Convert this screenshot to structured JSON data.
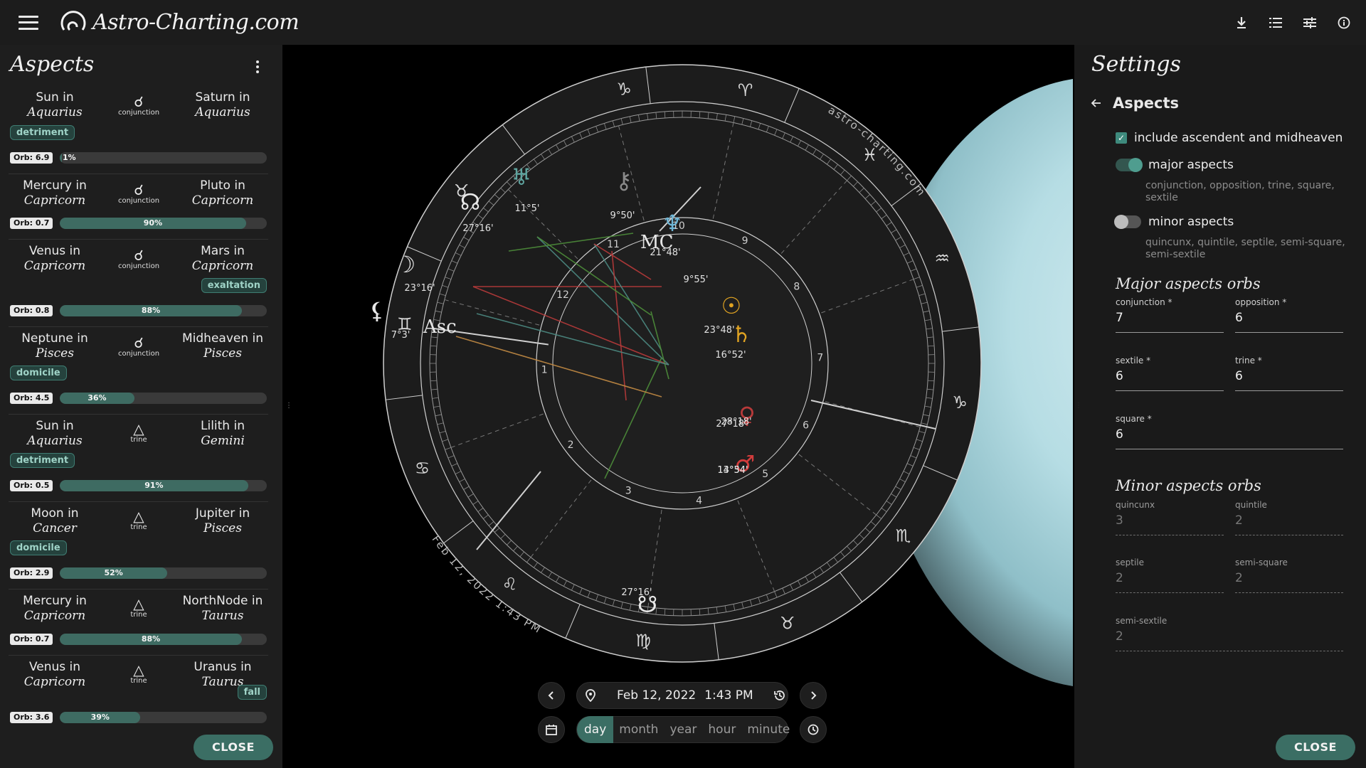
{
  "app": {
    "logo_text": "Astro-Charting.com"
  },
  "topbar": {
    "icons": [
      "menu-icon",
      "download-icon",
      "list-icon",
      "tune-icon",
      "info-icon"
    ]
  },
  "left_panel": {
    "title": "Aspects",
    "close_label": "CLOSE",
    "aspects": [
      {
        "body1": "Sun in",
        "sign1": "Aquarius",
        "aspect": "conjunction",
        "symbol": "☌",
        "body2": "Saturn in",
        "sign2": "Aquarius",
        "badge1": "detriment",
        "badge2": "",
        "orb": "Orb: 6.9",
        "pct": "1%",
        "fill": 0.01
      },
      {
        "body1": "Mercury in",
        "sign1": "Capricorn",
        "aspect": "conjunction",
        "symbol": "☌",
        "body2": "Pluto in",
        "sign2": "Capricorn",
        "badge1": "",
        "badge2": "",
        "orb": "Orb: 0.7",
        "pct": "90%",
        "fill": 0.9
      },
      {
        "body1": "Venus in",
        "sign1": "Capricorn",
        "aspect": "conjunction",
        "symbol": "☌",
        "body2": "Mars in",
        "sign2": "Capricorn",
        "badge1": "",
        "badge2": "exaltation",
        "orb": "Orb: 0.8",
        "pct": "88%",
        "fill": 0.88
      },
      {
        "body1": "Neptune in",
        "sign1": "Pisces",
        "aspect": "conjunction",
        "symbol": "☌",
        "body2": "Midheaven in",
        "sign2": "Pisces",
        "badge1": "domicile",
        "badge2": "",
        "orb": "Orb: 4.5",
        "pct": "36%",
        "fill": 0.36
      },
      {
        "body1": "Sun in",
        "sign1": "Aquarius",
        "aspect": "trine",
        "symbol": "△",
        "body2": "Lilith in",
        "sign2": "Gemini",
        "badge1": "detriment",
        "badge2": "",
        "orb": "Orb: 0.5",
        "pct": "91%",
        "fill": 0.91
      },
      {
        "body1": "Moon in",
        "sign1": "Cancer",
        "aspect": "trine",
        "symbol": "△",
        "body2": "Jupiter in",
        "sign2": "Pisces",
        "badge1": "domicile",
        "badge2": "",
        "orb": "Orb: 2.9",
        "pct": "52%",
        "fill": 0.52
      },
      {
        "body1": "Mercury in",
        "sign1": "Capricorn",
        "aspect": "trine",
        "symbol": "△",
        "body2": "NorthNode in",
        "sign2": "Taurus",
        "badge1": "",
        "badge2": "",
        "orb": "Orb: 0.7",
        "pct": "88%",
        "fill": 0.88
      },
      {
        "body1": "Venus in",
        "sign1": "Capricorn",
        "aspect": "trine",
        "symbol": "△",
        "body2": "Uranus in",
        "sign2": "Taurus",
        "badge1": "",
        "badge2": "fall",
        "orb": "Orb: 3.6",
        "pct": "39%",
        "fill": 0.39
      }
    ]
  },
  "chart": {
    "watermark": "astro-charting.com",
    "date_arc": "Feb 12, 2022 1:43 PM",
    "signs": [
      "♑",
      "♈",
      "♓",
      "♒",
      "♑",
      "♏",
      "♉",
      "♍",
      "♌",
      "♋",
      "♊",
      "♉"
    ],
    "angles": {
      "asc": "Asc",
      "mc": "MC"
    },
    "houses": [
      "1",
      "2",
      "3",
      "4",
      "5",
      "6",
      "7",
      "8",
      "9",
      "10",
      "11",
      "12"
    ],
    "planet_labels": [
      {
        "glyph": "☊",
        "deg": "27°16'"
      },
      {
        "glyph": "♅",
        "deg": "11°5'"
      },
      {
        "glyph": "⚷",
        "deg": "9°50'"
      },
      {
        "glyph": "♆",
        "deg": "21°48'"
      },
      {
        "glyph": "",
        "deg": "9°55'"
      },
      {
        "glyph": "☽",
        "deg": "23°16'"
      },
      {
        "glyph": "⚸",
        "deg": "7°3'"
      },
      {
        "glyph": "☉",
        "deg": "23°48'"
      },
      {
        "glyph": "♄",
        "deg": "16°52'"
      },
      {
        "glyph": "♀",
        "deg": "28°18'"
      },
      {
        "glyph": "",
        "deg": "27°18'"
      },
      {
        "glyph": "♂",
        "deg": "14°54'"
      },
      {
        "glyph": "",
        "deg": "13°34'"
      },
      {
        "glyph": "☋",
        "deg": "27°16'"
      }
    ]
  },
  "date_nav": {
    "date": "Feb 12, 2022",
    "time": "1:43 PM",
    "segments": [
      "day",
      "month",
      "year",
      "hour",
      "minute"
    ],
    "active": "day"
  },
  "right_panel": {
    "title": "Settings",
    "section": "Aspects",
    "include_label": "include ascendent and midheaven",
    "major_label": "major aspects",
    "major_hint": "conjunction, opposition, trine, square, sextile",
    "minor_label": "minor aspects",
    "minor_hint": "quincunx, quintile, septile, semi-square, semi-sextile",
    "major_orbs_title": "Major aspects orbs",
    "major_orbs": [
      {
        "label": "conjunction *",
        "value": "7"
      },
      {
        "label": "opposition *",
        "value": "6"
      },
      {
        "label": "sextile *",
        "value": "6"
      },
      {
        "label": "trine *",
        "value": "6"
      },
      {
        "label": "square *",
        "value": "6"
      }
    ],
    "minor_orbs_title": "Minor aspects orbs",
    "minor_orbs": [
      {
        "label": "quincunx",
        "value": "3"
      },
      {
        "label": "quintile",
        "value": "2"
      },
      {
        "label": "septile",
        "value": "2"
      },
      {
        "label": "semi-square",
        "value": "2"
      },
      {
        "label": "semi-sextile",
        "value": "2"
      }
    ],
    "close_label": "CLOSE",
    "colors": {
      "accent": "#3b6e64",
      "check": "#3e8a7d"
    }
  }
}
